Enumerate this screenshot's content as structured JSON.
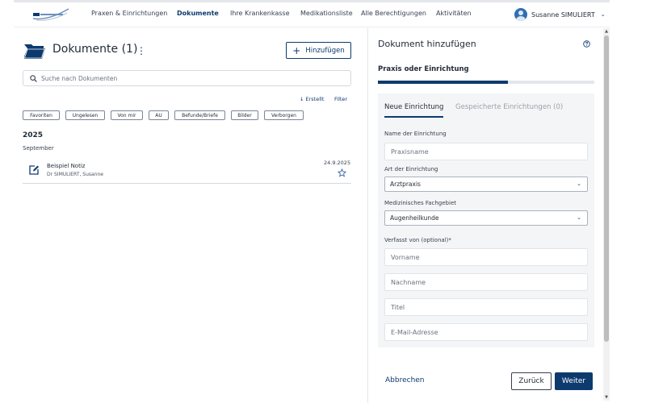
{
  "header": {
    "nav": [
      {
        "label": "Praxen & Einrichtungen",
        "active": false
      },
      {
        "label": "Dokumente",
        "active": true
      },
      {
        "label": "Ihre Krankenkasse",
        "active": false
      },
      {
        "label": "Medikationsliste",
        "active": false
      },
      {
        "label": "Alle Berechtigungen",
        "active": false
      },
      {
        "label": "Aktivitäten",
        "active": false
      }
    ],
    "user_name": "Susanne SIMULIERT"
  },
  "documents": {
    "title": "Dokumente (1)",
    "add_label": "Hinzufügen",
    "search_placeholder": "Suche nach Dokumenten",
    "sort_label": "Erstellt",
    "filter_label": "Filter",
    "chips": [
      "Favoriten",
      "Ungelesen",
      "Von mir",
      "AU",
      "Befunde/Briefe",
      "Bilder",
      "Verborgen"
    ],
    "year": "2025",
    "month": "September",
    "items": [
      {
        "name": "Beispiel Notiz",
        "author": "Dr SIMULIERT, Susanne",
        "date": "24.9.2025"
      }
    ]
  },
  "add_document": {
    "title": "Dokument hinzufügen",
    "step_title": "Praxis oder Einrichtung",
    "progress": 0.6,
    "tabs": {
      "active": "Neue Einrichtung",
      "inactive": "Gespeicherte Einrichtungen (0)"
    },
    "fields": {
      "name_label": "Name der Einrichtung",
      "name_placeholder": "Praxisname",
      "type_label": "Art der Einrichtung",
      "type_value": "Arztpraxis",
      "specialty_label": "Medizinisches Fachgebiet",
      "specialty_value": "Augenheilkunde",
      "author_label": "Verfasst von (optional)*",
      "first_name_placeholder": "Vorname",
      "last_name_placeholder": "Nachname",
      "title_placeholder": "Titel",
      "email_placeholder": "E-Mail-Adresse"
    },
    "cancel_label": "Abbrechen",
    "back_label": "Zurück",
    "next_label": "Weiter"
  },
  "colors": {
    "primary": "#0d3a6e",
    "card_bg": "#f4f5f7",
    "border": "#d5d9df"
  }
}
